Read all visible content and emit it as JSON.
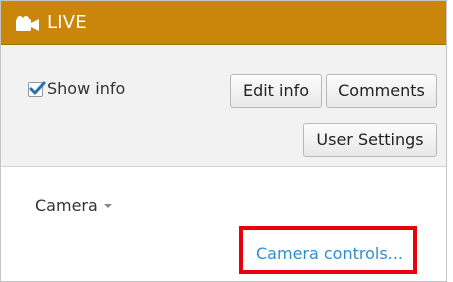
{
  "header": {
    "title": "LIVE",
    "icon": "video-camera-icon",
    "background_color": "#c9860a"
  },
  "info": {
    "show_info_label": "Show info",
    "show_info_checked": true
  },
  "buttons": {
    "edit_info": "Edit info",
    "comments": "Comments",
    "user_settings": "User Settings"
  },
  "camera": {
    "dropdown_label": "Camera",
    "controls_link": "Camera controls...",
    "link_color": "#2d8fd0"
  },
  "highlight_color": "#e8000b"
}
